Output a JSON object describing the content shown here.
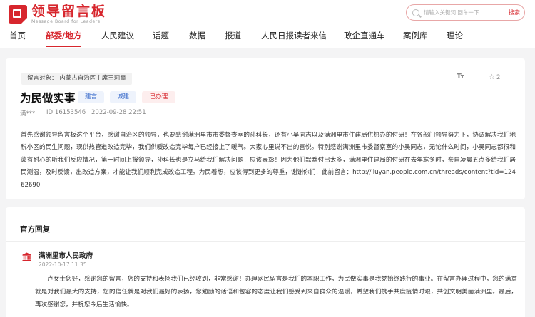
{
  "header": {
    "logo_cn": "领导留言板",
    "logo_en": "Message Board for Leaders",
    "search_placeholder": "请输入关键词 回车一下",
    "search_button": "搜索"
  },
  "nav": {
    "items": [
      "首页",
      "部委/地方",
      "人民建议",
      "话题",
      "数据",
      "报道",
      "人民日报读者来信",
      "政企直通车",
      "案例库",
      "理论"
    ],
    "active_index": 1
  },
  "message": {
    "addressee": "留言对象：  内蒙古自治区主席王莉霞",
    "font_toggle": "T",
    "star_count": "2",
    "title": "为民做实事",
    "tags": [
      "建言",
      "城建",
      "已办理"
    ],
    "author": "满***",
    "id": "ID:16153546",
    "datetime": "2022-09-28 22:51",
    "body": "首先感谢领导留言板这个平台，感谢自治区的领导，也要感谢满洲里市市委督查室的孙科长，还有小吴同志以及满洲里市住建局供热办的付研！在各部门领导努力下，协调解决我们地税小区的民生问题，现供热管道改造完毕，我们供暖改造完毕每户已经接上了暖气。大家心里说不出的喜悦。特别感谢满洲里市委督察室的小吴同志，无论什么时间，小吴同志都很和蔼有耐心的听我们反应情况，第一时间上报领导，孙科长也是立马给我们解决问题！应该表彰！因为他们默默付出太多，满洲里住建局的付研在去年寒冬时，亲自凌晨五点多给我们居民测温，及时反馈，出改造方案，才能让我们顺利完成改造工程。为民着想，应该得到更多的尊重，谢谢你们！此前留言：http://liuyan.people.com.cn/threads/content?tid=12462690"
  },
  "reply": {
    "section_title": "官方回复",
    "org_name": "满洲里市人民政府",
    "datetime": "2022-10-17 11:35",
    "text": "卢女士您好，感谢您的留言，您的支持和表扬我们已经收到，非常感谢！办理网民留言是我们的本职工作，为民做实事是我党始终践行的事业。在留言办理过程中，您的满意就是对我们最大的支持，您的信任就是对我们最好的表扬，您勉励的话语和包容的态度让我们感受到来自群众的温暖，希望我们携手共度疫情时艰，共创文明美丽满洲里。最后，再次感谢您，并祝您今后生活愉快。"
  },
  "colors": {
    "accent": "#d7262d",
    "tag_blue": "#3f6fcc",
    "tag_blue_bg": "#eef3fc",
    "tag_red_bg": "#fdeeee"
  },
  "icons": [
    "search-icon",
    "font-size-icon",
    "star-icon",
    "government-building-icon"
  ]
}
